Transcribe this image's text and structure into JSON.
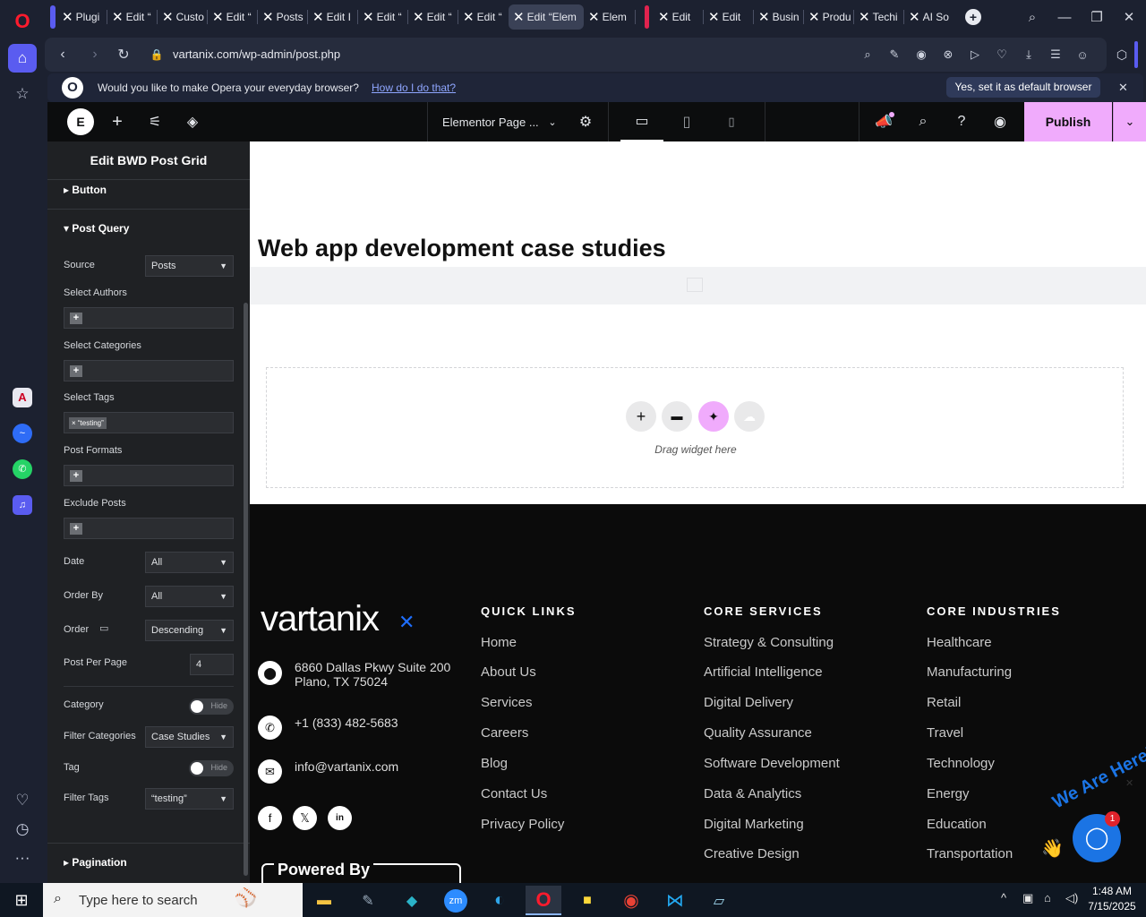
{
  "colors": {
    "opera_red": "#ff1b2d",
    "elementor_pink": "#f0abfc",
    "footer_bg": "#0b0b0b",
    "chat_blue": "#1b74e4",
    "vartanix_blue": "#1f6fff"
  },
  "browser": {
    "tabs": [
      {
        "label": "Plugi",
        "active": false
      },
      {
        "label": "Edit “",
        "active": false
      },
      {
        "label": "Custo",
        "active": false
      },
      {
        "label": "Edit “",
        "active": false
      },
      {
        "label": "Posts",
        "active": false
      },
      {
        "label": "Edit I",
        "active": false
      },
      {
        "label": "Edit “",
        "active": false
      },
      {
        "label": "Edit “",
        "active": false
      },
      {
        "label": "Edit “",
        "active": false
      },
      {
        "label": "Edit “Elem",
        "active": true
      },
      {
        "label": "Elem",
        "active": false
      },
      {
        "label": "Edit",
        "active": false
      },
      {
        "label": "Edit",
        "active": false
      },
      {
        "label": "Busin",
        "active": false
      },
      {
        "label": "Produ",
        "active": false
      },
      {
        "label": "Techi",
        "active": false
      },
      {
        "label": "AI So",
        "active": false
      }
    ],
    "url": "vartanix.com/wp-admin/post.php",
    "banner": {
      "question": "Would you like to make Opera your everyday browser?",
      "link": "How do I do that?",
      "accept": "Yes, set it as default browser"
    }
  },
  "elementor": {
    "page_settings_label": "Elementor Page ...",
    "publish_label": "Publish",
    "panel_title": "Edit BWD Post Grid",
    "sections": {
      "button": "Button",
      "post_query": "Post Query",
      "pagination": "Pagination"
    },
    "fields": {
      "source": {
        "label": "Source",
        "value": "Posts"
      },
      "select_authors": "Select Authors",
      "select_categories": "Select Categories",
      "select_tags": {
        "label": "Select Tags",
        "chip": "× “testing”"
      },
      "post_formats": "Post Formats",
      "exclude_posts": "Exclude Posts",
      "date": {
        "label": "Date",
        "value": "All"
      },
      "order_by": {
        "label": "Order By",
        "value": "All"
      },
      "order": {
        "label": "Order",
        "value": "Descending"
      },
      "post_per_page": {
        "label": "Post Per Page",
        "value": "4"
      },
      "category": {
        "label": "Category",
        "toggle": "Hide"
      },
      "filter_categories": {
        "label": "Filter Categories",
        "value": "Case Studies"
      },
      "tag": {
        "label": "Tag",
        "toggle": "Hide"
      },
      "filter_tags": {
        "label": "Filter Tags",
        "value": "“testing”"
      }
    }
  },
  "canvas": {
    "heading": "Web app development case studies",
    "drop_hint": "Drag widget here"
  },
  "footer": {
    "logo": "vartanix",
    "address_line1": "6860 Dallas Pkwy Suite 200",
    "address_line2": "Plano, TX 75024",
    "phone": "+1 (833) 482-5683",
    "email": "info@vartanix.com",
    "powered_by": "Powered By",
    "quick_links": {
      "title": "QUICK LINKS",
      "items": [
        "Home",
        "About Us",
        "Services",
        "Careers",
        "Blog",
        "Contact Us",
        "Privacy Policy"
      ]
    },
    "core_services": {
      "title": "CORE SERVICES",
      "items": [
        "Strategy & Consulting",
        "Artificial Intelligence",
        "Digital Delivery",
        "Quality Assurance",
        "Software Development",
        "Data & Analytics",
        "Digital Marketing",
        "Creative Design"
      ]
    },
    "core_industries": {
      "title": "CORE INDUSTRIES",
      "items": [
        "Healthcare",
        "Manufacturing",
        "Retail",
        "Travel",
        "Technology",
        "Energy",
        "Education",
        "Transportation"
      ]
    }
  },
  "chat": {
    "badge_text": "We Are Here!",
    "unread_count": "1"
  },
  "taskbar": {
    "search_placeholder": "Type here to search",
    "time": "1:48 AM",
    "date": "7/15/2025"
  }
}
